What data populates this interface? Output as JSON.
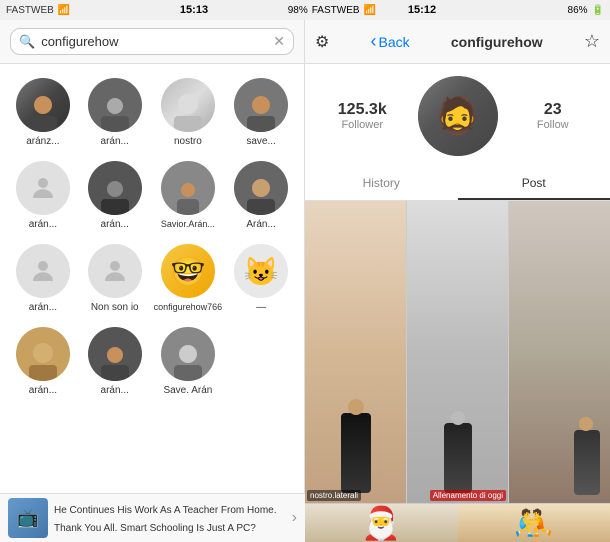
{
  "statusBar": {
    "left": {
      "carrier": "FASTWEB",
      "time": "15:13",
      "battery": "98%"
    },
    "right": {
      "carrier": "FASTWEB",
      "time": "15:12",
      "battery": "86%"
    }
  },
  "leftPanel": {
    "navBar": {
      "gearIcon": "⚙"
    },
    "search": {
      "placeholder": "configurehow",
      "value": "configurehow",
      "clearIcon": "✕"
    },
    "results": [
      {
        "id": 1,
        "label": "aránz...",
        "hasAvatar": true,
        "avatarClass": "img-person1"
      },
      {
        "id": 2,
        "label": "arán...",
        "hasAvatar": true,
        "avatarClass": "img-person2"
      },
      {
        "id": 3,
        "label": "nostro",
        "hasAvatar": true,
        "avatarClass": "img-nostro"
      },
      {
        "id": 4,
        "label": "save...",
        "hasAvatar": true,
        "avatarClass": "img-save"
      },
      {
        "id": 5,
        "label": "arán...",
        "hasAvatar": false
      },
      {
        "id": 6,
        "label": "arán...",
        "hasAvatar": true,
        "avatarClass": "img-person5"
      },
      {
        "id": 7,
        "label": "Savior.Arán...",
        "hasAvatar": true,
        "avatarClass": "img-savior"
      },
      {
        "id": 8,
        "label": "Arán...",
        "hasAvatar": true,
        "avatarClass": "img-person6"
      },
      {
        "id": 9,
        "label": "arán...",
        "hasAvatar": false
      },
      {
        "id": 10,
        "label": "Non son io",
        "hasAvatar": false
      },
      {
        "id": 11,
        "label": "configurehow766",
        "hasAvatar": true,
        "avatarClass": "img-simpsons"
      },
      {
        "id": 12,
        "label": "—",
        "hasAvatar": false
      },
      {
        "id": 13,
        "label": "arán...",
        "hasAvatar": true,
        "avatarClass": "img-aran8"
      },
      {
        "id": 14,
        "label": "arán...",
        "hasAvatar": true,
        "avatarClass": "img-aran9"
      },
      {
        "id": 15,
        "label": "Save. Arán",
        "hasAvatar": true,
        "avatarClass": "img-person4"
      }
    ],
    "ad": {
      "text": "He Continues His Work As A Teacher From Home. Thank You All. Smart Schooling Is Just A PC?",
      "arrowIcon": "›"
    }
  },
  "rightPanel": {
    "navBar": {
      "backLabel": "Back",
      "backIcon": "‹",
      "title": "configurehow",
      "starIcon": "☆"
    },
    "profile": {
      "followerCount": "125.3k",
      "followerLabel": "Follower",
      "followCount": "23",
      "followLabel": "Follow"
    },
    "tabs": [
      {
        "id": "history",
        "label": "History",
        "active": false
      },
      {
        "id": "post",
        "label": "Post",
        "active": true
      }
    ],
    "posts": [
      {
        "id": 1,
        "label": "nostro.laterali",
        "labelType": "default"
      },
      {
        "id": 2,
        "label": "Allenamento di oggi",
        "labelType": "red"
      },
      {
        "id": 3,
        "label": "",
        "labelType": "none"
      }
    ]
  }
}
